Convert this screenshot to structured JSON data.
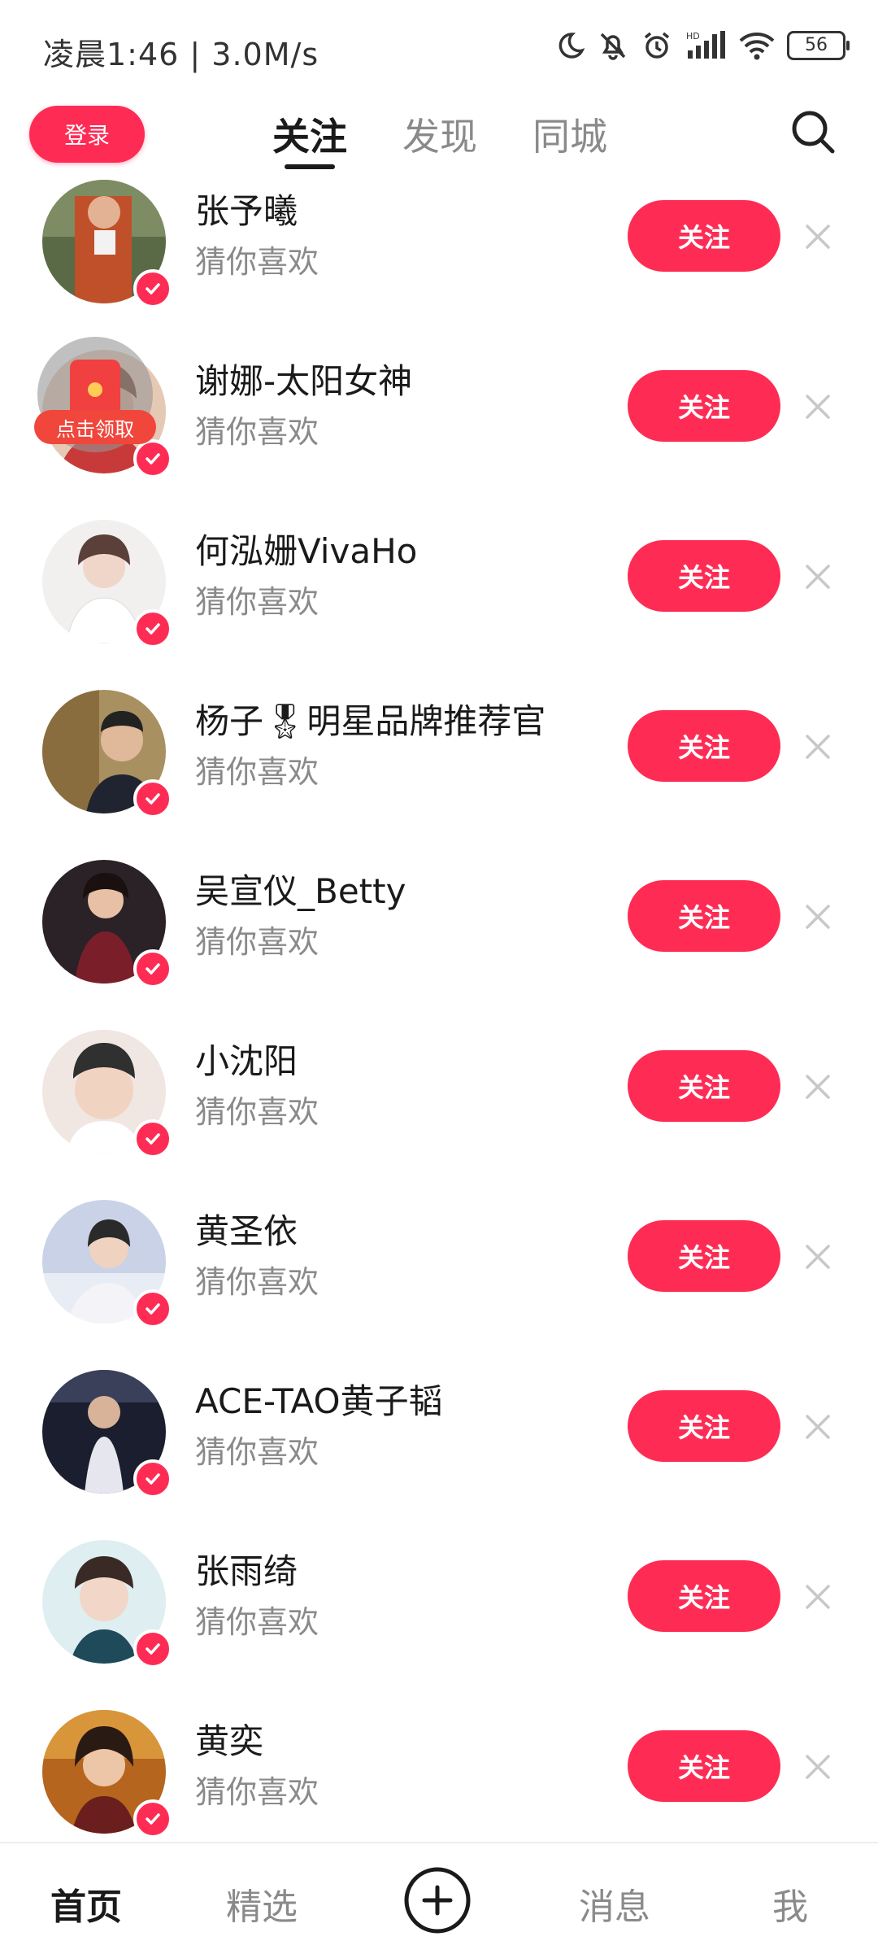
{
  "status": {
    "time": "凌晨1:46 | 3.0M/s",
    "battery": "56"
  },
  "topnav": {
    "login_label": "登录",
    "tabs": [
      {
        "label": "关注",
        "active": true
      },
      {
        "label": "发现",
        "active": false
      },
      {
        "label": "同城",
        "active": false
      }
    ]
  },
  "list": {
    "follow_label": "关注",
    "red_packet_label": "点击领取",
    "items": [
      {
        "name": "张予曦",
        "subtitle": "猜你喜欢"
      },
      {
        "name": "谢娜-太阳女神",
        "subtitle": "猜你喜欢"
      },
      {
        "name": "何泓姗VivaHo",
        "subtitle": "猜你喜欢"
      },
      {
        "name": "杨子🎖明星品牌推荐官",
        "subtitle": "猜你喜欢"
      },
      {
        "name": "吴宣仪_Betty",
        "subtitle": "猜你喜欢"
      },
      {
        "name": "小沈阳",
        "subtitle": "猜你喜欢"
      },
      {
        "name": "黄圣依",
        "subtitle": "猜你喜欢"
      },
      {
        "name": "ACE-TAO黄子韬",
        "subtitle": "猜你喜欢"
      },
      {
        "name": "张雨绮",
        "subtitle": "猜你喜欢"
      },
      {
        "name": "黄奕",
        "subtitle": "猜你喜欢"
      }
    ]
  },
  "bottomnav": {
    "items": [
      {
        "label": "首页",
        "active": true
      },
      {
        "label": "精选",
        "active": false
      },
      {
        "label": "消息",
        "active": false
      },
      {
        "label": "我",
        "active": false
      }
    ]
  },
  "colors": {
    "accent": "#fe2c55",
    "text_primary": "#1a1a1a",
    "text_secondary": "#8a8a8a"
  }
}
